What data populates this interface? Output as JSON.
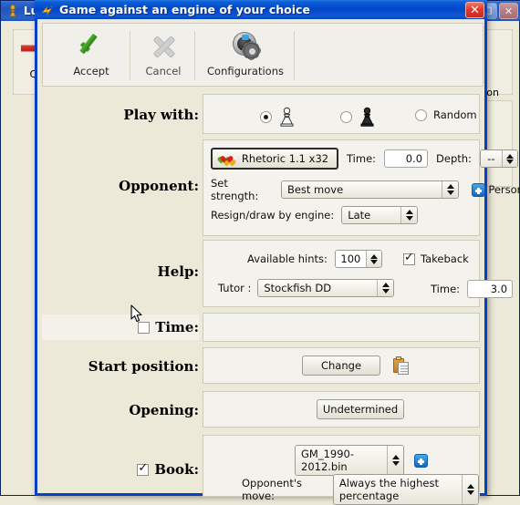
{
  "background_window": {
    "title": "Lu",
    "icon": "chess-pawn-icon",
    "restore_label": "❐",
    "close_label": "✕",
    "toolbar": {
      "quit_label": "Quit",
      "quit_icon": "exit-arrow-icon"
    },
    "right_fragment_text": "ion"
  },
  "dialog": {
    "title": "Game against an engine of your choice",
    "title_icon": "engine-icon",
    "close_label": "✕",
    "toolbar": [
      {
        "label": "Accept",
        "icon": "green-check-icon"
      },
      {
        "label": "Cancel",
        "icon": "grey-x-icon"
      },
      {
        "label": "Configurations",
        "icon": "gear-icon"
      }
    ],
    "play_with": {
      "label": "Play with:",
      "options": [
        {
          "name": "white",
          "label": "",
          "icon": "white-pawn-icon",
          "selected": true
        },
        {
          "name": "black",
          "label": "",
          "icon": "black-pawn-icon",
          "selected": false
        },
        {
          "name": "random",
          "label": "Random",
          "icon": "",
          "selected": false
        }
      ]
    },
    "opponent": {
      "label": "Opponent:",
      "engine_button": {
        "text": "Rhetoric 1.1 x32",
        "icon": "hearts-icon"
      },
      "time_label": "Time:",
      "time_value": "0.0",
      "depth_label": "Depth:",
      "depth_value": "--",
      "set_strength_label": "Set strength:",
      "set_strength_value": "Best move",
      "personality_label": "Personality",
      "personality_icon": "blue-plus-icon",
      "resign_label": "Resign/draw by engine:",
      "resign_value": "Late"
    },
    "help": {
      "label": "Help:",
      "hints_label": "Available hints:",
      "hints_value": "100",
      "takeback_label": "Takeback",
      "takeback_checked": true,
      "tutor_label": "Tutor :",
      "tutor_value": "Stockfish DD",
      "time_label": "Time:",
      "time_value": "3.0"
    },
    "time": {
      "label": "Time:",
      "checked": false
    },
    "start_position": {
      "label": "Start position:",
      "change_button": "Change",
      "paste_icon": "clipboard-icon"
    },
    "opening": {
      "label": "Opening:",
      "button": "Undetermined"
    },
    "book": {
      "label": "Book:",
      "checked": true,
      "file_value": "GM_1990-2012.bin",
      "add_icon": "blue-plus-icon",
      "opponent_move_label": "Opponent's move:",
      "opponent_move_value": "Always the highest percentage"
    }
  },
  "colors": {
    "title_blue": "#0640c8",
    "dialog_bg": "#ece9d8",
    "panel_bg": "#f3f2ec",
    "accent_blue": "#1168bb",
    "accept_green": "#3c9a23",
    "close_red": "#d32a1c"
  }
}
